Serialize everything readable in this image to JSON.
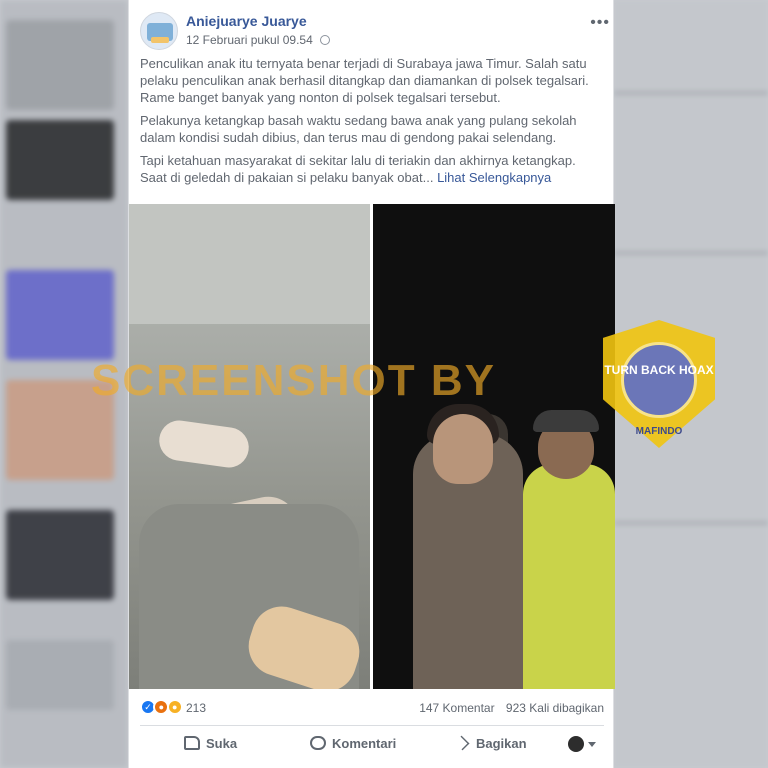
{
  "post": {
    "author": "Aniejuarye Juarye",
    "timestamp": "12 Februari pukul 09.54",
    "paragraphs": [
      "Penculikan anak itu ternyata benar terjadi di Surabaya jawa Timur. Salah satu pelaku penculikan anak berhasil ditangkap dan diamankan di polsek tegalsari. Rame banget banyak yang nonton di polsek tegalsari tersebut.",
      "Pelakunya ketangkap basah waktu sedang bawa anak yang pulang sekolah dalam kondisi sudah dibius, dan terus mau di gendong pakai selendang."
    ],
    "last_paragraph": "Tapi ketahuan masyarakat di sekitar lalu di teriakin dan akhirnya ketangkap. Saat di geledah di pakaian si pelaku banyak obat...",
    "see_more": "Lihat Selengkapnya"
  },
  "overlay": {
    "watermark": "SCREENSHOT BY",
    "badge_main": "TURN BACK HOAX",
    "badge_bottom": "MAFINDO",
    "badge_color": "#f1c40f"
  },
  "engagement": {
    "reaction_count": "213",
    "comments": "147 Komentar",
    "shares": "923 Kali dibagikan"
  },
  "actions": {
    "like": "Suka",
    "comment": "Komentari",
    "share": "Bagikan"
  },
  "colors": {
    "link": "#385898",
    "text": "#616770"
  }
}
